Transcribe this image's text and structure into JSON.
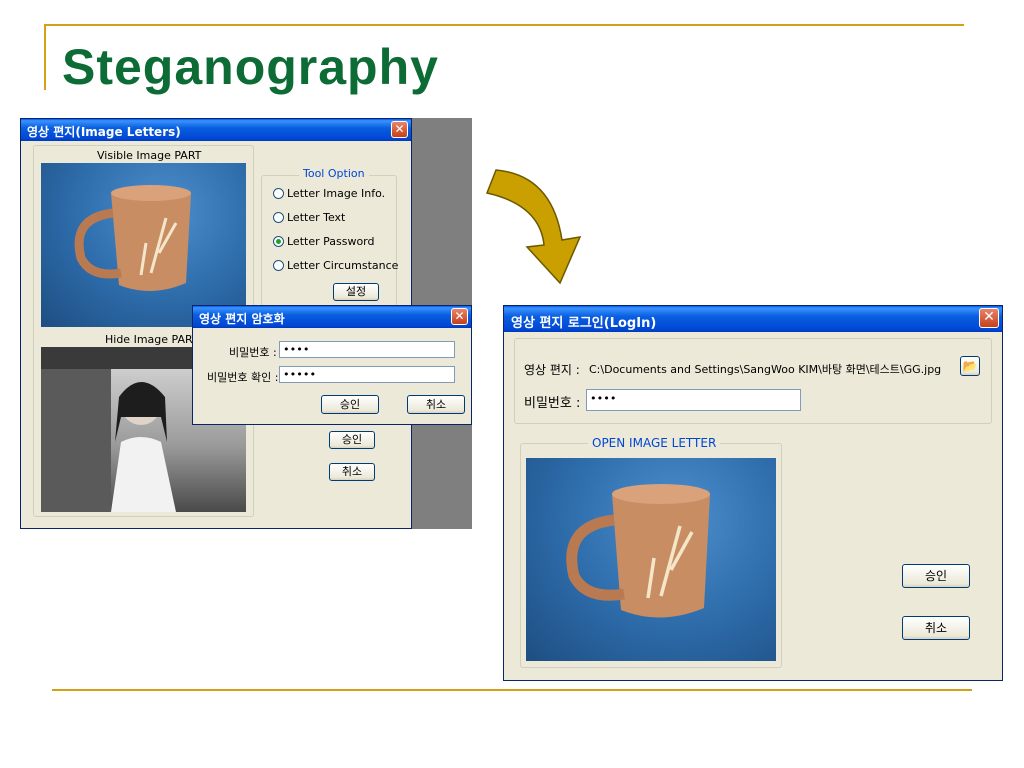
{
  "slide": {
    "title": "Steganography"
  },
  "colors": {
    "accent_rule": "#d4a017",
    "title_green": "#0d6b35",
    "arrow_gold": "#c9a000",
    "xp_blue": "#0046d5"
  },
  "main_window": {
    "title": "영상 편지(Image Letters)",
    "visible_part_label": "Visible Image PART",
    "hide_part_label": "Hide Image PART",
    "tool_option": {
      "label": "Tool Option",
      "options": [
        {
          "label": "Letter Image Info.",
          "selected": false
        },
        {
          "label": "Letter Text",
          "selected": false
        },
        {
          "label": "Letter Password",
          "selected": true
        },
        {
          "label": "Letter Circumstance",
          "selected": false
        }
      ],
      "settings_button": "설정"
    },
    "approve_button": "승인",
    "cancel_button": "취소"
  },
  "encrypt_dialog": {
    "title": "영상 편지 암호화",
    "password_label": "비밀번호 :",
    "password_value": "••••",
    "confirm_label": "비밀번호 확인 :",
    "confirm_value": "•••••",
    "approve_button": "승인",
    "cancel_button": "취소"
  },
  "login_window": {
    "title": "영상 편지 로그인(LogIn)",
    "letter_label": "영상 편지 :",
    "letter_path": "C:\\Documents and Settings\\SangWoo KIM\\바탕 화면\\테스트\\GG.jpg",
    "password_label": "비밀번호 :",
    "password_value": "••••",
    "open_group_label": "OPEN IMAGE LETTER",
    "approve_button": "승인",
    "cancel_button": "취소",
    "folder_icon": "folder-open-icon"
  }
}
